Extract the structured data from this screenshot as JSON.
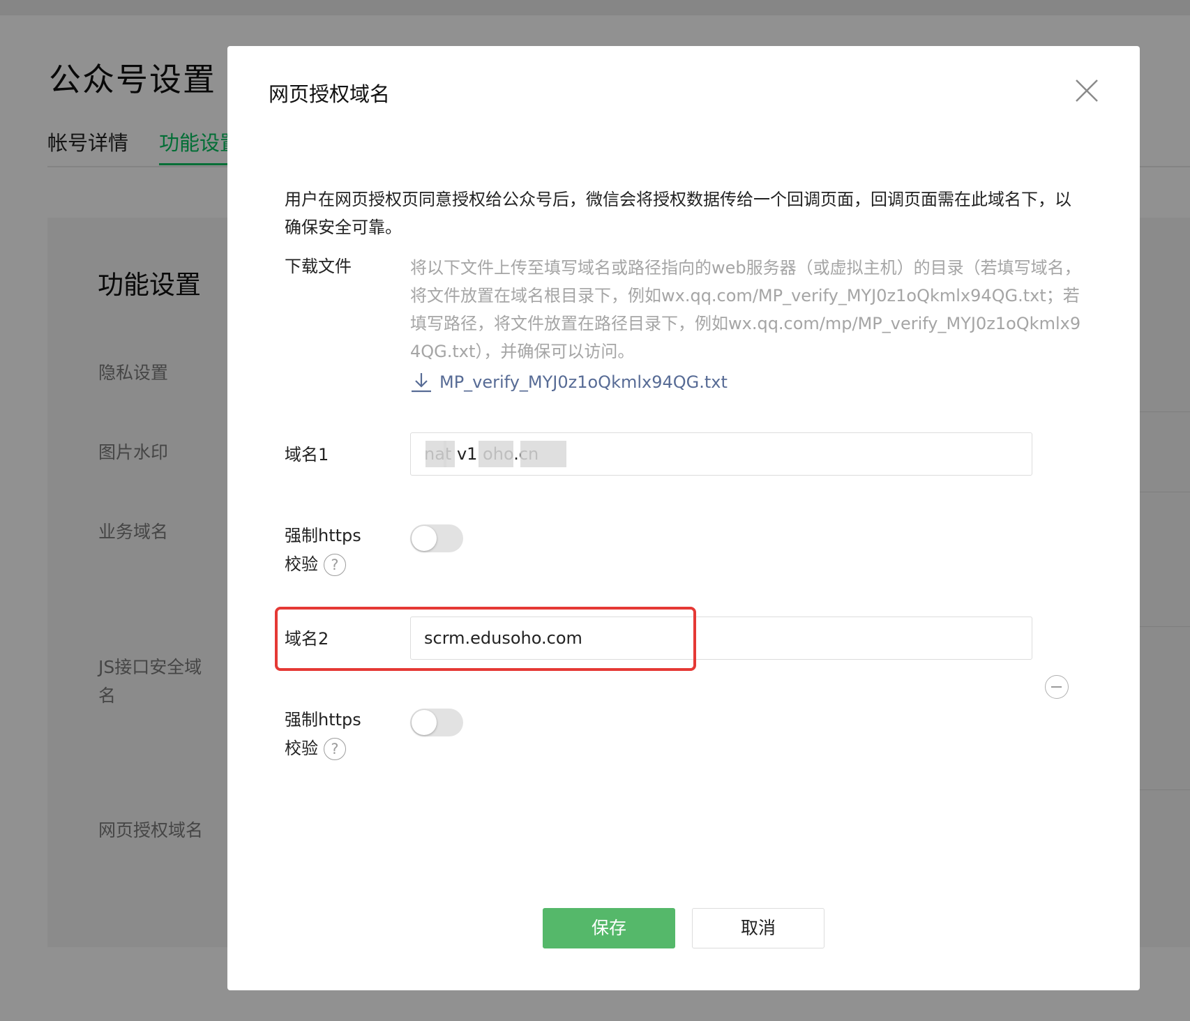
{
  "background": {
    "page_title": "公众号设置",
    "tabs": [
      "帐号详情",
      "功能设置"
    ],
    "section_title": "功能设置",
    "side_items": [
      "隐私设置",
      "图片水印",
      "业务域名",
      "JS接口安全域名",
      "网页授权域名"
    ]
  },
  "dialog": {
    "title": "网页授权域名",
    "description": "用户在网页授权页同意授权给公众号后，微信会将授权数据传给一个回调页面，回调页面需在此域名下，以确保安全可靠。",
    "download_label": "下载文件",
    "download_text": "将以下文件上传至填写域名或路径指向的web服务器（或虚拟主机）的目录（若填写域名，将文件放置在域名根目录下，例如wx.qq.com/MP_verify_MYJ0z1oQkmlx94QG.txt；若填写路径，将文件放置在路径目录下，例如wx.qq.com/mp/MP_verify_MYJ0z1oQkmlx94QG.txt），并确保可以访问。",
    "download_file": "MP_verify_MYJ0z1oQkmlx94QG.txt",
    "domain1_label": "域名1",
    "domain1_value": "nat v1 oho.cn",
    "force_https_label_1": "强制https",
    "force_https_label_2": "校验",
    "help_symbol": "?",
    "domain2_label": "域名2",
    "domain2_value": "scrm.edusoho.com",
    "save_label": "保存",
    "cancel_label": "取消"
  },
  "colors": {
    "accent": "#07c160",
    "save_button": "#55b86a",
    "link": "#576b95",
    "highlight": "#e53935"
  }
}
